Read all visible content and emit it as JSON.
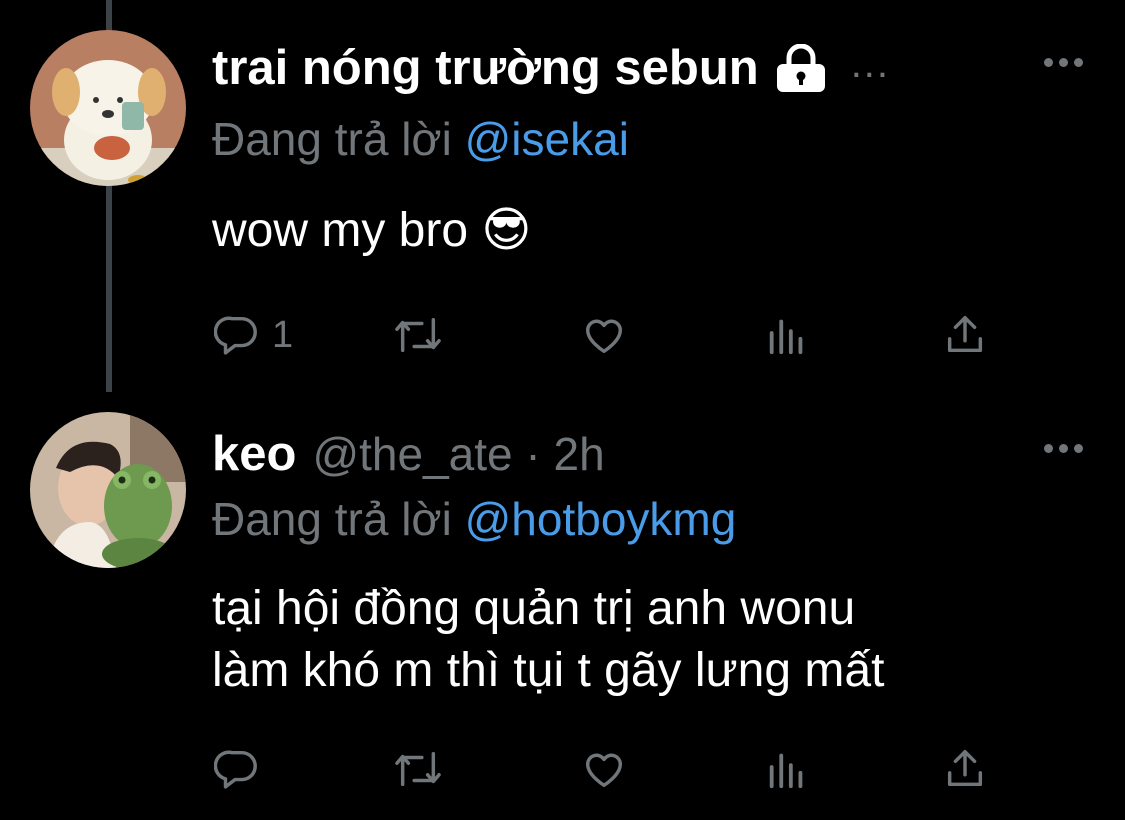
{
  "tweets": [
    {
      "display_name": "trai nóng trường sebun",
      "handle": "",
      "time": "",
      "protected": true,
      "truncation": "...",
      "reply_prefix": "Đang trả lời",
      "reply_to": "@isekai",
      "text": "wow my bro 😎",
      "actions": {
        "reply_count": "1",
        "retweet_count": "",
        "like_count": ""
      },
      "avatar_icon": "cartoon-dog-avatar"
    },
    {
      "display_name": "keo",
      "handle": "@the_ate · 2h",
      "protected": false,
      "reply_prefix": "Đang trả lời",
      "reply_to": "@hotboykmg",
      "text_line1": "tại hội đồng quản trị anh wonu",
      "text_line2": "làm khó m thì tụi t gãy lưng mất",
      "actions": {
        "reply_count": "",
        "retweet_count": "",
        "like_count": ""
      },
      "avatar_icon": "photo-person-with-frog-avatar"
    }
  ],
  "colors": {
    "background": "#000000",
    "secondary_text": "#71767b",
    "mention": "#4a9ce8",
    "thread_line": "#3d4247"
  },
  "icons": [
    "reply-icon",
    "retweet-icon",
    "like-icon",
    "views-icon",
    "share-icon",
    "more-icon",
    "lock-icon"
  ]
}
